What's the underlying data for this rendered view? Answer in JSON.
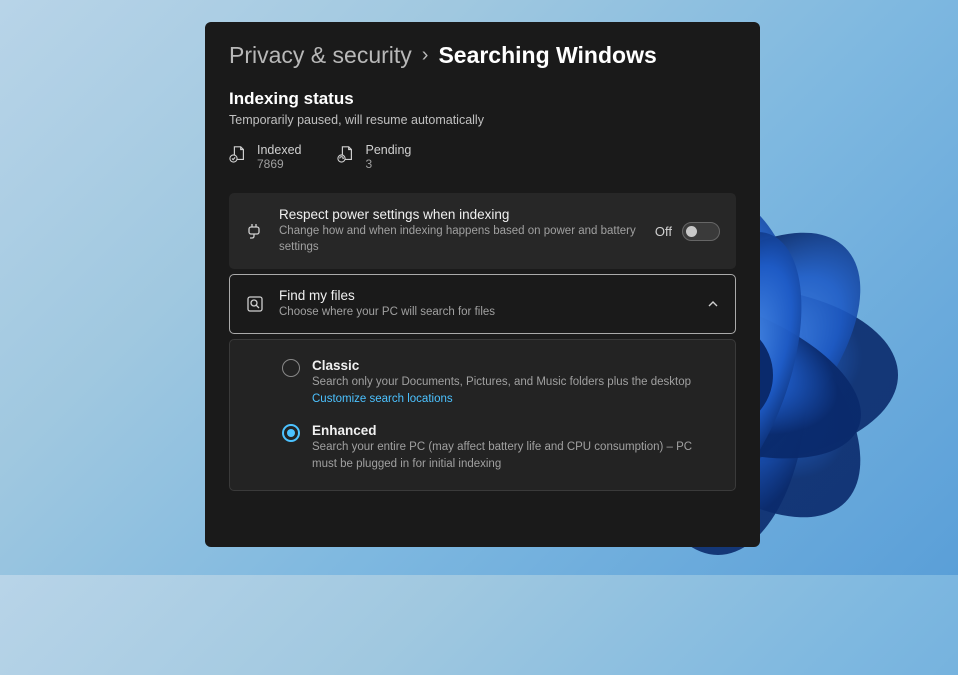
{
  "breadcrumb": {
    "parent": "Privacy & security",
    "current": "Searching Windows"
  },
  "indexing": {
    "title": "Indexing status",
    "description": "Temporarily paused, will resume automatically",
    "stats": {
      "indexed": {
        "label": "Indexed",
        "value": "7869"
      },
      "pending": {
        "label": "Pending",
        "value": "3"
      }
    }
  },
  "power_card": {
    "title": "Respect power settings when indexing",
    "description": "Change how and when indexing happens based on power and battery settings",
    "toggle_state": "Off"
  },
  "find_files_card": {
    "title": "Find my files",
    "description": "Choose where your PC will search for files"
  },
  "radio_options": {
    "classic": {
      "title": "Classic",
      "description": "Search only your Documents, Pictures, and Music folders plus the desktop",
      "link": "Customize search locations",
      "selected": false
    },
    "enhanced": {
      "title": "Enhanced",
      "description": "Search your entire PC (may affect battery life and CPU consumption) – PC must be plugged in for initial indexing",
      "selected": true
    }
  },
  "colors": {
    "accent": "#4cc2ff",
    "panel_bg": "#1a1a1a",
    "card_bg": "#272727"
  }
}
